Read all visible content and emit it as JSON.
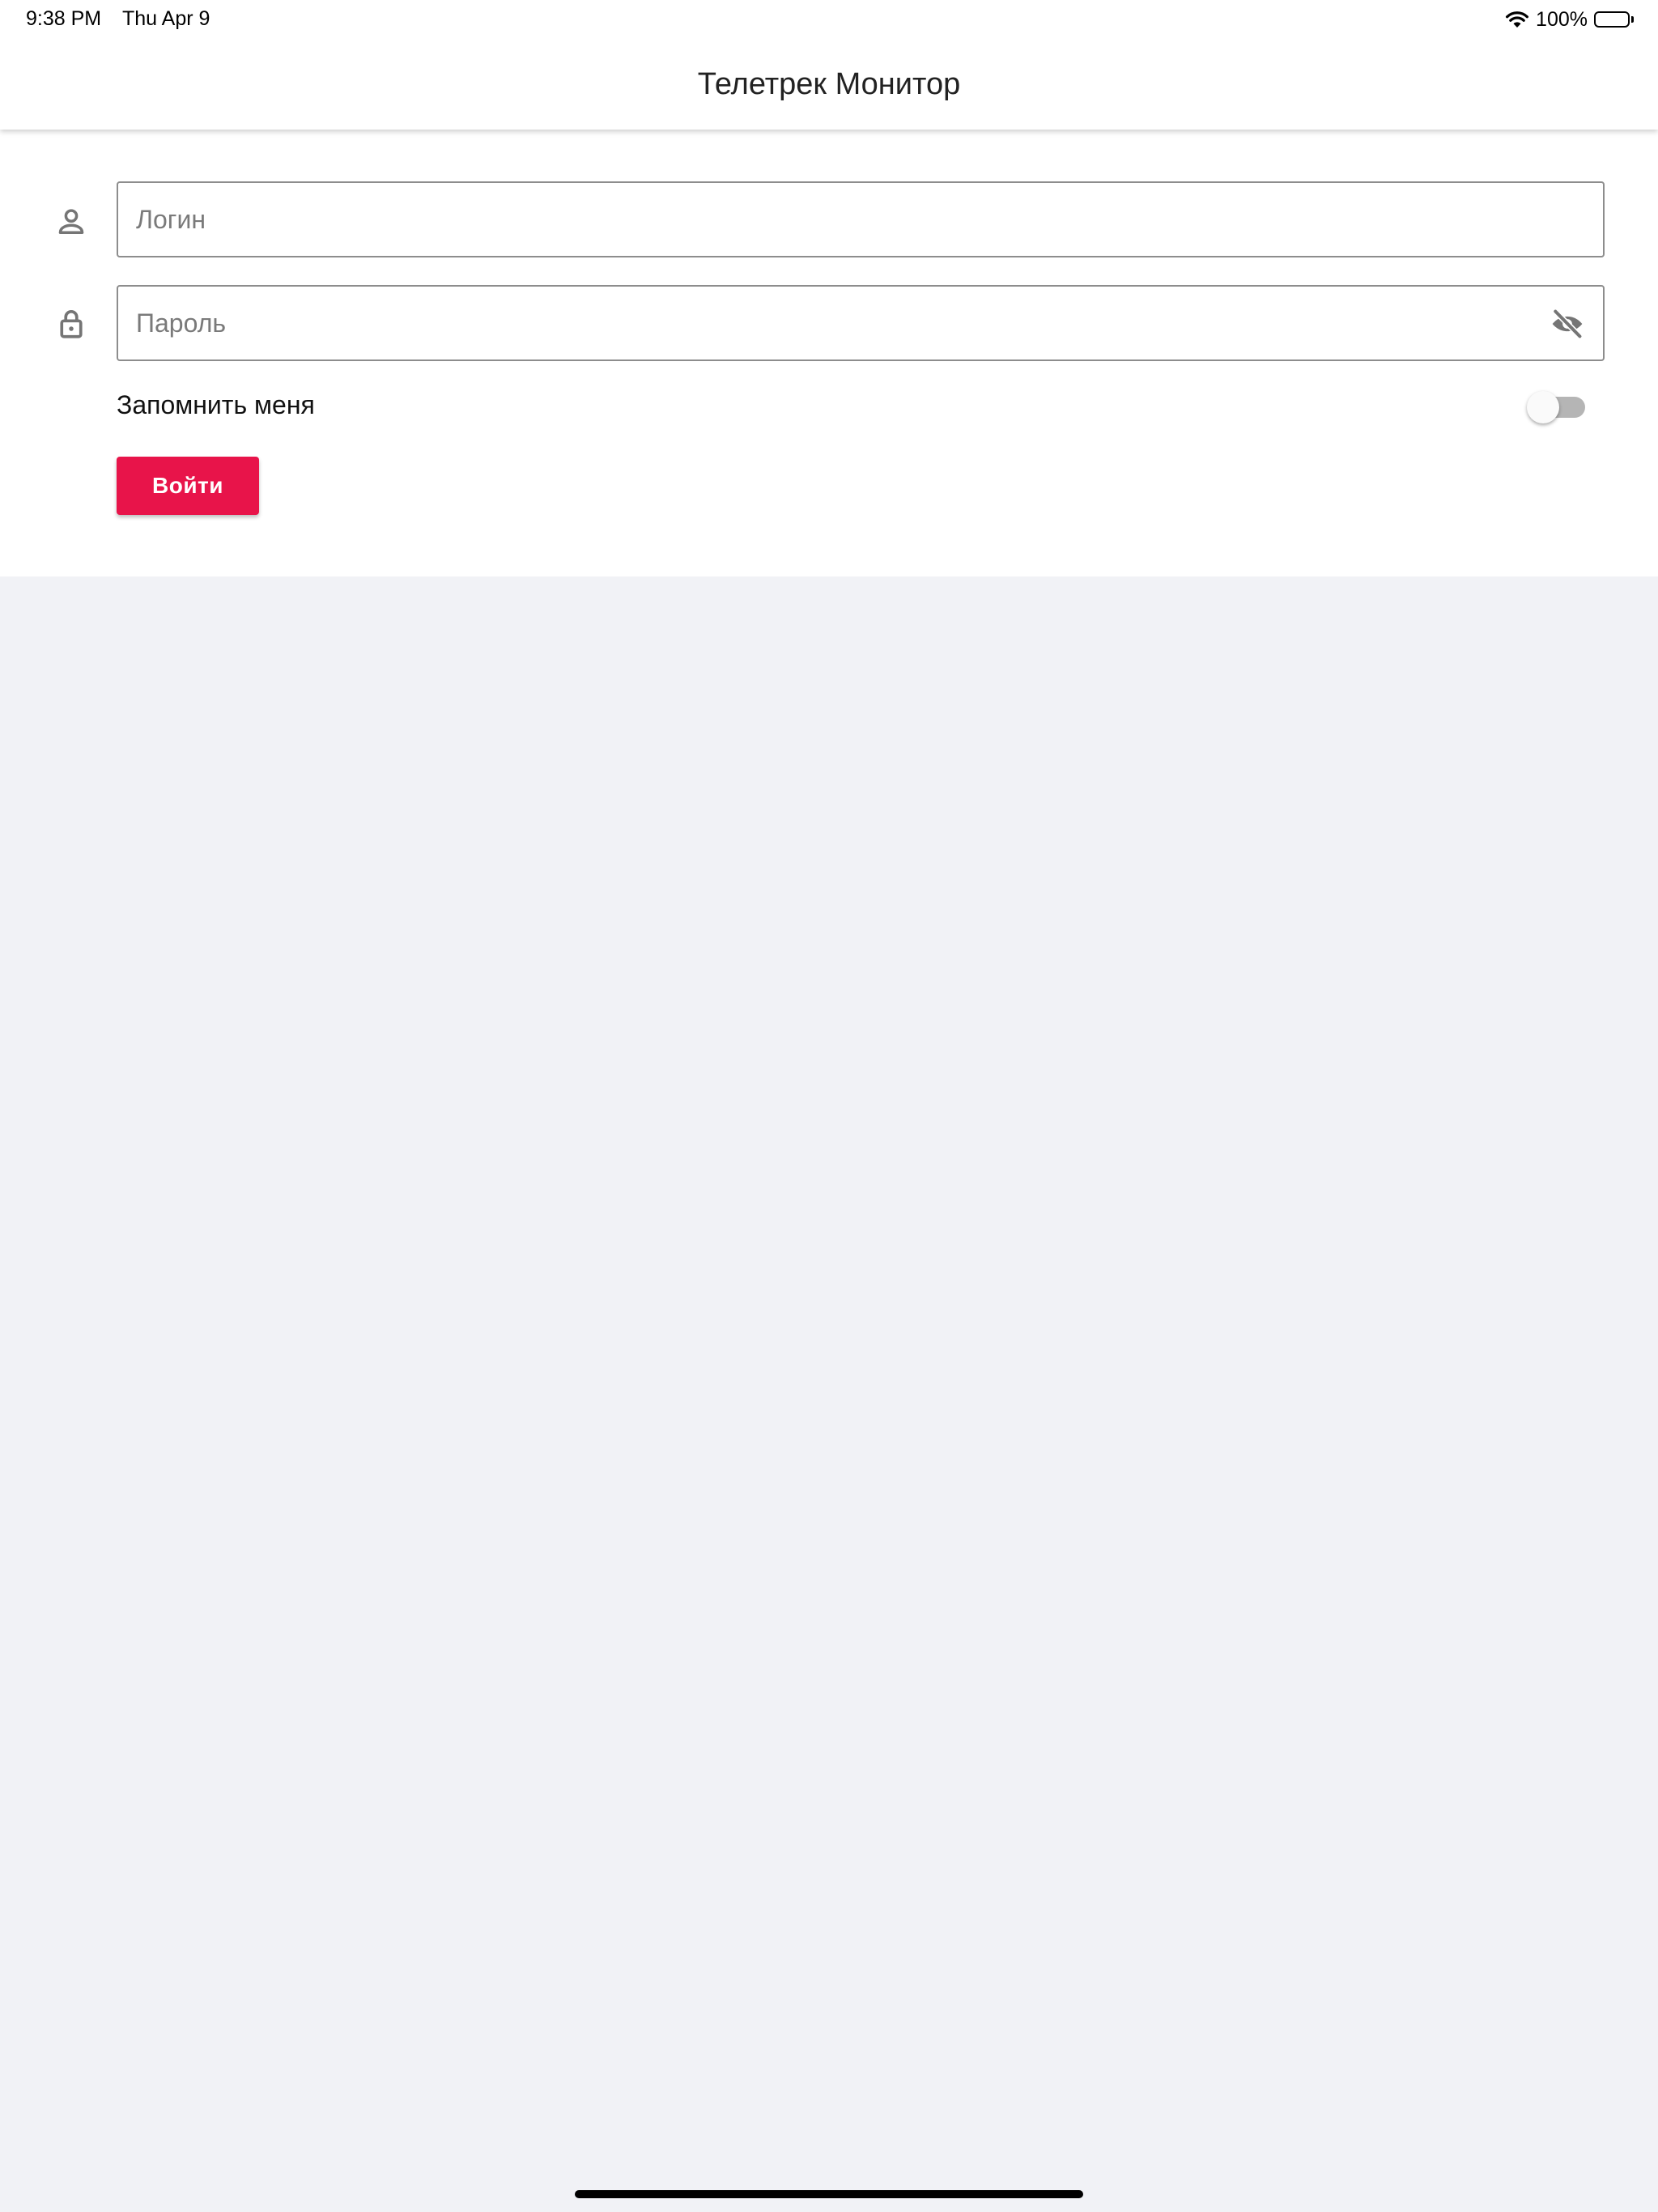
{
  "status_bar": {
    "time": "9:38 PM",
    "date": "Thu Apr 9",
    "battery": "100%",
    "battery_level": 1.0
  },
  "header": {
    "title": "Телетрек Монитор"
  },
  "form": {
    "login": {
      "placeholder": "Логин",
      "value": "",
      "icon": "person-icon"
    },
    "password": {
      "placeholder": "Пароль",
      "value": "",
      "icon": "lock-icon",
      "visibility_icon": "eye-off-icon"
    },
    "remember": {
      "label": "Запомнить меня",
      "checked": false
    },
    "submit_label": "Войти"
  },
  "colors": {
    "accent": "#e8144a",
    "background": "#f1f2f6",
    "panel": "#ffffff",
    "border": "#8d8d8d",
    "icon": "#757575"
  }
}
